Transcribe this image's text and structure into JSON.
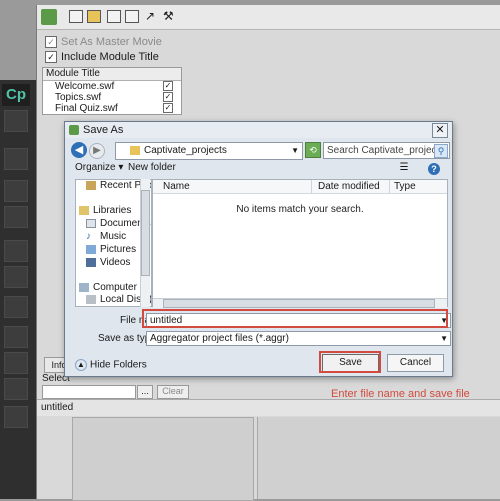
{
  "captivate": {
    "logo": "Cp"
  },
  "aggregator": {
    "options": {
      "master_movie": "Set As Master Movie",
      "include_module_title": "Include Module Title"
    },
    "module_table": {
      "header": "Module Title",
      "rows": [
        {
          "title": "Welcome.swf",
          "checked": true
        },
        {
          "title": "Topics.swf",
          "checked": true
        },
        {
          "title": "Final Quiz.swf",
          "checked": true
        }
      ]
    },
    "info_tab": "Info",
    "select_label": "Select",
    "browse_button": "...",
    "clear_button": "Clear",
    "status_text": "untitled"
  },
  "dialog": {
    "title": "Save As",
    "address": "Captivate_projects",
    "search_placeholder": "Search Captivate_projects",
    "organize": "Organize ▾",
    "new_folder": "New folder",
    "nav_items": [
      "Recent Place",
      "Libraries",
      "Documents",
      "Music",
      "Pictures",
      "Videos",
      "Computer",
      "Local Disk (C"
    ],
    "columns": {
      "name": "Name",
      "date": "Date modified",
      "type": "Type"
    },
    "empty_message": "No items match your search.",
    "file_name_label": "File name:",
    "file_name_value": "untitled",
    "save_as_type_label": "Save as type:",
    "save_as_type_value": "Aggregator project files (*.aggr)",
    "hide_folders": "Hide Folders",
    "save_button": "Save",
    "cancel_button": "Cancel"
  },
  "annotation": {
    "callout": "Enter file name and save file",
    "highlight_color": "#d24b3e"
  }
}
